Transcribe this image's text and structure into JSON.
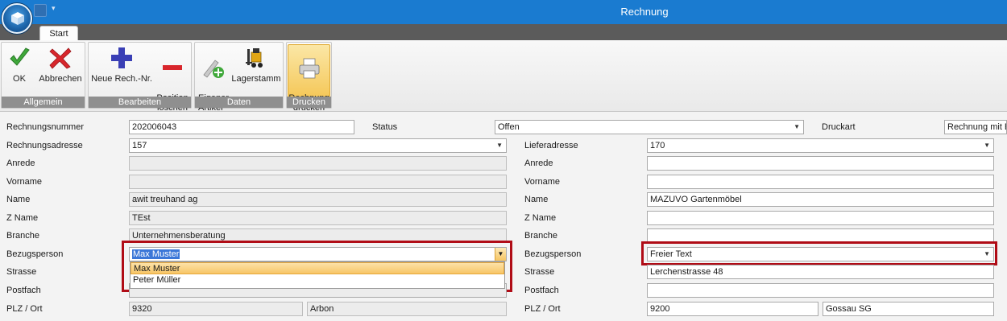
{
  "window": {
    "title": "Rechnung"
  },
  "tabs": [
    {
      "label": "Start"
    }
  ],
  "ribbon": {
    "groups": [
      {
        "label": "Allgemein",
        "buttons": [
          {
            "label": "OK",
            "icon": "checkmark-icon"
          },
          {
            "label": "Abbrechen",
            "icon": "red-x-icon"
          }
        ]
      },
      {
        "label": "Bearbeiten",
        "buttons": [
          {
            "label": "Neue Rech.-Nr.",
            "icon": "plus-icon"
          },
          {
            "label": "Position\nlöschen",
            "icon": "minus-icon"
          }
        ]
      },
      {
        "label": "Daten",
        "buttons": [
          {
            "label": "Eigener\nArtikel",
            "icon": "add-article-icon"
          },
          {
            "label": "Lagerstamm",
            "icon": "forklift-icon"
          }
        ]
      },
      {
        "label": "Drucken",
        "buttons": [
          {
            "label": "Rechnung\ndrucken",
            "icon": "printer-icon"
          }
        ]
      }
    ]
  },
  "form": {
    "rechnungsnummer": {
      "label": "Rechnungsnummer",
      "value": "202006043"
    },
    "status": {
      "label": "Status",
      "value": "Offen"
    },
    "druckart": {
      "label": "Druckart",
      "value": "Rechnung mit E"
    },
    "left": {
      "rechnungsadresse": {
        "label": "Rechnungsadresse",
        "value": "157"
      },
      "anrede": {
        "label": "Anrede",
        "value": ""
      },
      "vorname": {
        "label": "Vorname",
        "value": ""
      },
      "name": {
        "label": "Name",
        "value": "awit treuhand ag"
      },
      "zname": {
        "label": "Z Name",
        "value": "TEst"
      },
      "branche": {
        "label": "Branche",
        "value": "Unternehmensberatung"
      },
      "bezugsperson": {
        "label": "Bezugsperson",
        "value": "Max Muster",
        "options": [
          "Max Muster",
          "Peter Müller"
        ]
      },
      "strasse": {
        "label": "Strasse",
        "value": ""
      },
      "postfach": {
        "label": "Postfach",
        "value": ""
      },
      "plzort": {
        "label": "PLZ / Ort",
        "plz": "9320",
        "ort": "Arbon"
      }
    },
    "right": {
      "lieferadresse": {
        "label": "Lieferadresse",
        "value": "170"
      },
      "anrede": {
        "label": "Anrede",
        "value": ""
      },
      "vorname": {
        "label": "Vorname",
        "value": ""
      },
      "name": {
        "label": "Name",
        "value": "MAZUVO Gartenmöbel"
      },
      "zname": {
        "label": "Z Name",
        "value": ""
      },
      "branche": {
        "label": "Branche",
        "value": ""
      },
      "bezugsperson": {
        "label": "Bezugsperson",
        "value": "Freier Text"
      },
      "strasse": {
        "label": "Strasse",
        "value": "Lerchenstrasse 48"
      },
      "postfach": {
        "label": "Postfach",
        "value": ""
      },
      "plzort": {
        "label": "PLZ / Ort",
        "plz": "9200",
        "ort": "Gossau SG"
      }
    }
  },
  "colors": {
    "titlebar": "#1a7bd0",
    "highlight": "#b00c16",
    "selection": "#3b77d8"
  }
}
